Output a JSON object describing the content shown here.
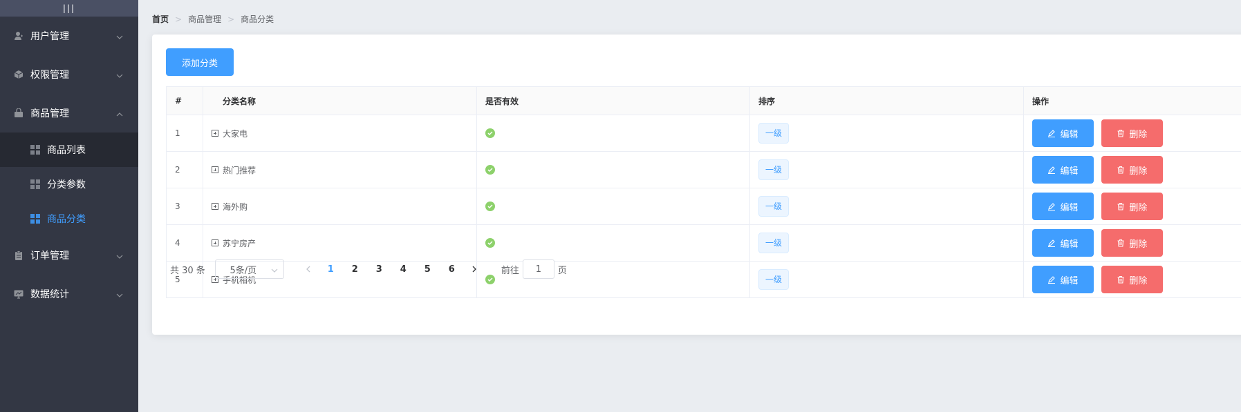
{
  "sidebar": {
    "toggle_label": "|||",
    "menus": [
      {
        "label": "用户管理",
        "icon": "user-icon",
        "expanded": false
      },
      {
        "label": "权限管理",
        "icon": "box-icon",
        "expanded": false
      },
      {
        "label": "商品管理",
        "icon": "bag-icon",
        "expanded": true,
        "children": [
          {
            "label": "商品列表",
            "active": false
          },
          {
            "label": "分类参数",
            "active": false
          },
          {
            "label": "商品分类",
            "active": true
          }
        ]
      },
      {
        "label": "订单管理",
        "icon": "clipboard-icon",
        "expanded": false
      },
      {
        "label": "数据统计",
        "icon": "monitor-icon",
        "expanded": false
      }
    ]
  },
  "breadcrumb": [
    "首页",
    "商品管理",
    "商品分类"
  ],
  "toolbar": {
    "add_label": "添加分类"
  },
  "table": {
    "headers": [
      "#",
      "分类名称",
      "是否有效",
      "排序",
      "操作"
    ],
    "rows": [
      {
        "index": "1",
        "name": "大家电",
        "valid": true,
        "level": "一级"
      },
      {
        "index": "2",
        "name": "热门推荐",
        "valid": true,
        "level": "一级"
      },
      {
        "index": "3",
        "name": "海外购",
        "valid": true,
        "level": "一级"
      },
      {
        "index": "4",
        "name": "苏宁房产",
        "valid": true,
        "level": "一级"
      },
      {
        "index": "5",
        "name": "手机相机",
        "valid": true,
        "level": "一级"
      }
    ],
    "edit_label": "编辑",
    "delete_label": "删除"
  },
  "pagination": {
    "total_text": "共 30 条",
    "page_size": "5条/页",
    "pages": [
      "1",
      "2",
      "3",
      "4",
      "5",
      "6"
    ],
    "current_page": "1",
    "goto_prefix": "前往",
    "goto_value": "1",
    "goto_suffix": "页"
  },
  "colors": {
    "sidebar_bg": "#333744",
    "primary": "#409eff",
    "danger": "#f56c6c",
    "success": "#67c23a"
  }
}
